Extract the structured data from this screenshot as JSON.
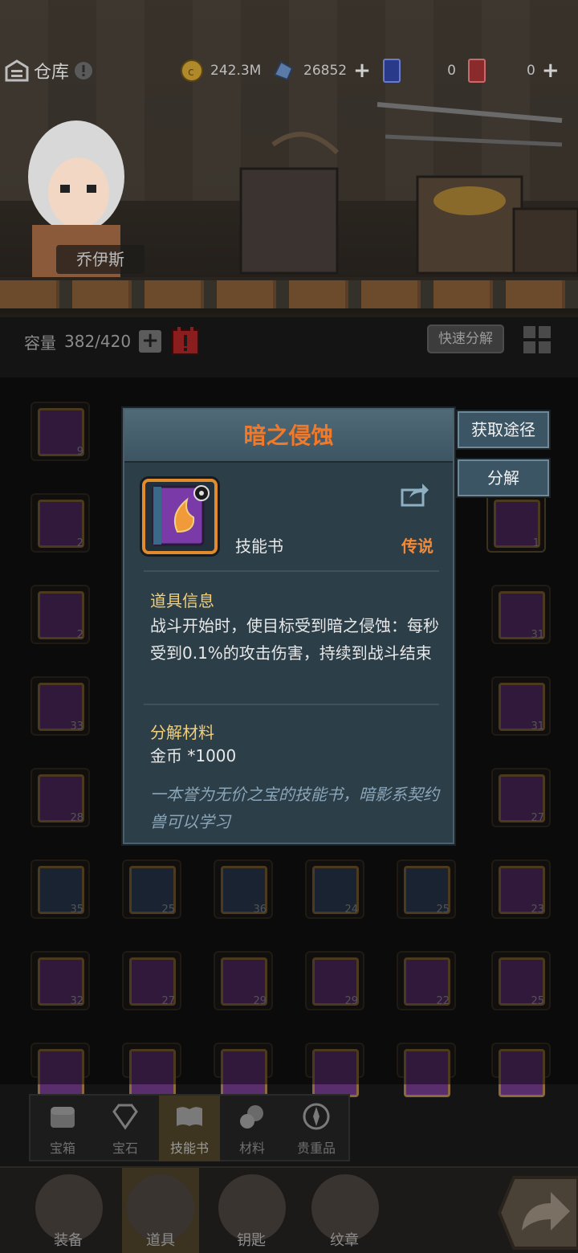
{
  "header": {
    "title": "仓库",
    "gold": "242.3M",
    "gems": "26852",
    "ticket_blue": "0",
    "ticket_red": "0"
  },
  "scene": {
    "character_name": "乔伊斯"
  },
  "capacity": {
    "label": "容量",
    "value": "382/420",
    "quick_decompose": "快速分解"
  },
  "grid_counts": {
    "row1": [
      "9"
    ],
    "row2": [
      "2",
      "1"
    ],
    "row3": [
      "2",
      "31"
    ],
    "row4": [
      "33",
      "31"
    ],
    "row5": [
      "28",
      "27"
    ],
    "row6": [
      "35",
      "25",
      "36",
      "24",
      "25",
      "23"
    ],
    "row7": [
      "32",
      "27",
      "29",
      "29",
      "22",
      "25"
    ]
  },
  "tooltip": {
    "name": "暗之侵蚀",
    "type": "技能书",
    "rarity": "传说",
    "info_title": "道具信息",
    "info_body": "战斗开始时，使目标受到暗之侵蚀：每秒受到0.1%的攻击伤害，持续到战斗结束",
    "material_title": "分解材料",
    "material_body": "金币 *1000",
    "flavor": "一本誉为无价之宝的技能书，暗影系契约兽可以学习",
    "colors": {
      "title": "#f07a2a",
      "rarity": "#f08a3a",
      "section": "#f2d07a",
      "flavor": "#8aa6b8"
    }
  },
  "side_actions": {
    "obtain": "获取途径",
    "decompose": "分解"
  },
  "categories": [
    "宝箱",
    "宝石",
    "技能书",
    "材料",
    "贵重品"
  ],
  "nav": [
    "装备",
    "道具",
    "钥匙",
    "纹章"
  ]
}
